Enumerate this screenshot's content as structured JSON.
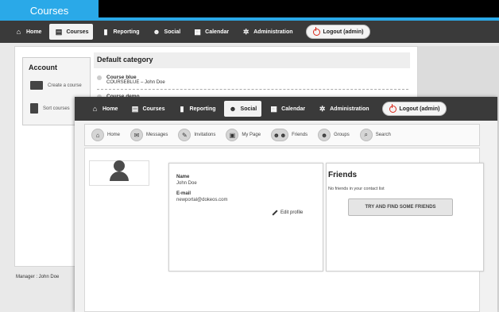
{
  "back_window": {
    "title_tab": "Courses",
    "nav": [
      {
        "label": "Home",
        "icon": "home-icon",
        "glyph": "⌂"
      },
      {
        "label": "Courses",
        "icon": "book-icon",
        "glyph": "▤",
        "active": true
      },
      {
        "label": "Reporting",
        "icon": "bar-chart-icon",
        "glyph": "▮"
      },
      {
        "label": "Social",
        "icon": "people-icon",
        "glyph": "☻"
      },
      {
        "label": "Calendar",
        "icon": "calendar-icon",
        "glyph": "▦"
      },
      {
        "label": "Administration",
        "icon": "gear-icon",
        "glyph": "✲"
      }
    ],
    "logout": "Logout (admin)",
    "account": {
      "title": "Account",
      "create_course": "Create a course",
      "sort_courses": "Sort courses"
    },
    "category_title": "Default category",
    "courses": [
      {
        "name": "Course blue",
        "detail": "COURSEBLUE – John Doe"
      },
      {
        "name": "Course demo",
        "detail": ""
      }
    ],
    "manager": "Manager : John Doe"
  },
  "front_window": {
    "nav": [
      {
        "label": "Home",
        "icon": "home-icon",
        "glyph": "⌂"
      },
      {
        "label": "Courses",
        "icon": "book-icon",
        "glyph": "▤"
      },
      {
        "label": "Reporting",
        "icon": "bar-chart-icon",
        "glyph": "▮"
      },
      {
        "label": "Social",
        "icon": "people-icon",
        "glyph": "☻",
        "active": true
      },
      {
        "label": "Calendar",
        "icon": "calendar-icon",
        "glyph": "▦"
      },
      {
        "label": "Administration",
        "icon": "gear-icon",
        "glyph": "✲"
      }
    ],
    "logout": "Logout (admin)",
    "subnav": [
      {
        "label": "Home",
        "icon": "home-icon",
        "glyph": "⌂"
      },
      {
        "label": "Messages",
        "icon": "messages-icon",
        "glyph": "✉"
      },
      {
        "label": "Invitations",
        "icon": "pen-icon",
        "glyph": "✎"
      },
      {
        "label": "My Page",
        "icon": "page-icon",
        "glyph": "▣"
      },
      {
        "label": "Friends",
        "icon": "friends-icon",
        "glyph": "☻☻"
      },
      {
        "label": "Groups",
        "icon": "groups-icon",
        "glyph": "☻"
      },
      {
        "label": "Search",
        "icon": "search-icon",
        "glyph": "⌕"
      }
    ],
    "profile": {
      "name_label": "Name",
      "name_value": "John Doe",
      "email_label": "E-mail",
      "email_value": "newportal@dokeos.com",
      "edit_label": "Edit profile"
    },
    "friends": {
      "title": "Friends",
      "empty_text": "No friends in your contact list",
      "button": "TRY AND FIND SOME FRIENDS"
    }
  },
  "colors": {
    "accent_blue": "#2aa9e8",
    "nav_dark": "#3a3a3a",
    "logout_red": "#d9281a"
  }
}
